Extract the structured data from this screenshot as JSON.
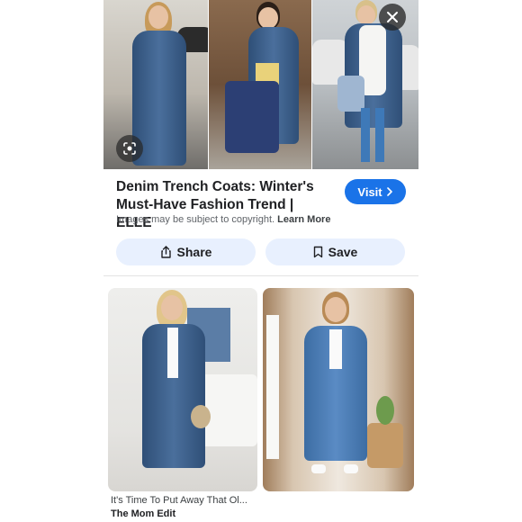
{
  "result": {
    "title": "Denim Trench Coats: Winter's Must-Have Fashion Trend | ELLE",
    "visit_label": "Visit",
    "copyright_text": "Images may be subject to copyright.",
    "learn_more": "Learn More"
  },
  "actions": {
    "share_label": "Share",
    "save_label": "Save"
  },
  "related": [
    {
      "caption": "It's Time To Put Away That Ol...",
      "source": "The Mom Edit"
    }
  ],
  "icons": {
    "lens": "google-lens-icon",
    "close": "close-icon",
    "share": "share-icon",
    "save": "bookmark-icon",
    "visit_chevron": "chevron-right-icon"
  },
  "colors": {
    "accent": "#1a73e8",
    "action_bg": "#e8f0fe",
    "denim": "#3f6593"
  }
}
